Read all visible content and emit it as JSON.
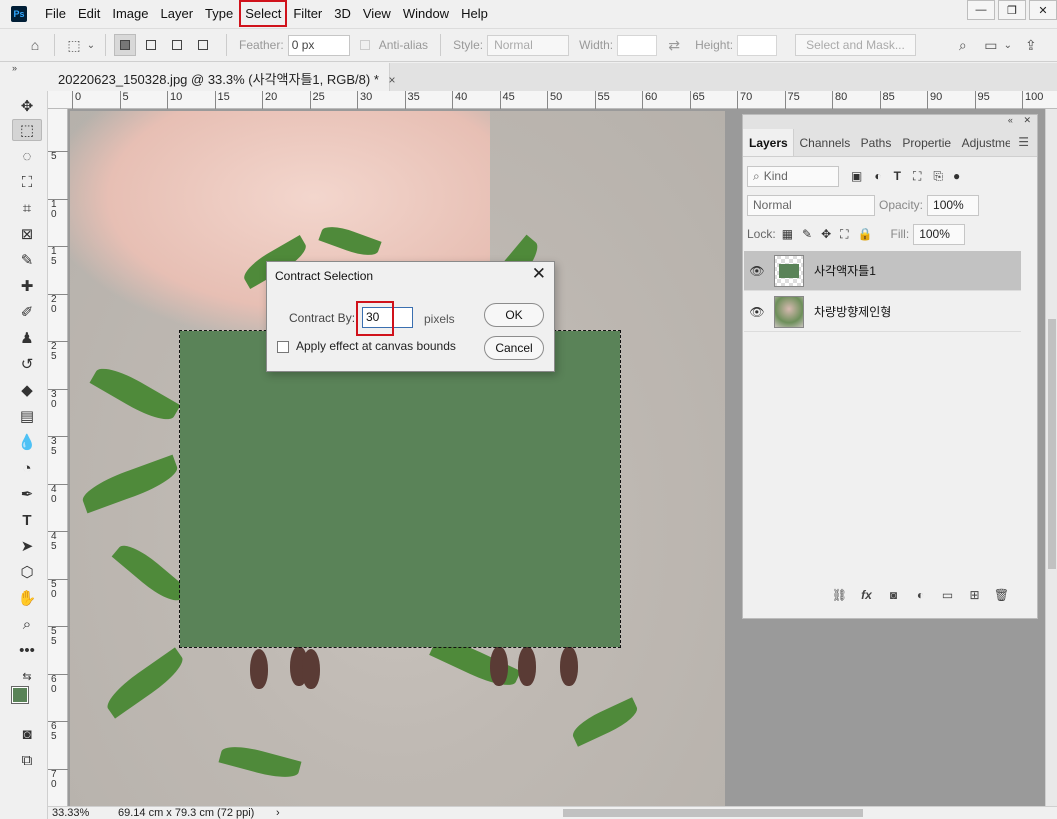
{
  "app": {
    "logo": "Ps"
  },
  "menu": [
    "File",
    "Edit",
    "Image",
    "Layer",
    "Type",
    "Select",
    "Filter",
    "3D",
    "View",
    "Window",
    "Help"
  ],
  "window_controls": {
    "minimize": "—",
    "restore": "❐",
    "close": "✕"
  },
  "options": {
    "feather_label": "Feather:",
    "feather_value": "0 px",
    "antialias_label": "Anti-alias",
    "style_label": "Style:",
    "style_value": "Normal",
    "width_label": "Width:",
    "height_label": "Height:",
    "select_mask_label": "Select and Mask..."
  },
  "tab": {
    "title": "20220623_150328.jpg @ 33.3% (사각액자틀1, RGB/8) *",
    "close": "×",
    "collapse": "»"
  },
  "ruler": {
    "h_labels": [
      "0",
      "5",
      "10",
      "15",
      "20",
      "25",
      "30",
      "35",
      "40",
      "45",
      "50",
      "55",
      "60",
      "65",
      "70",
      "75",
      "80",
      "85",
      "90",
      "95",
      "100"
    ],
    "v_labels": [
      "5",
      "1 0",
      "1 5",
      "2 0",
      "2 5",
      "3 0",
      "3 5",
      "4 0",
      "4 5",
      "5 0",
      "5 5",
      "6 0",
      "6 5",
      "7 0"
    ]
  },
  "layers_panel": {
    "collapse": "«",
    "close": "✕",
    "tabs": [
      "Layers",
      "Channels",
      "Paths",
      "Propertie",
      "Adjustme"
    ],
    "menu_icon": "☰",
    "kind_label": "Kind",
    "blend_mode": "Normal",
    "opacity_label": "Opacity:",
    "opacity_value": "100%",
    "lock_label": "Lock:",
    "fill_label": "Fill:",
    "fill_value": "100%",
    "layers": [
      {
        "name": "사각액자틀1",
        "selected": true
      },
      {
        "name": "차량방향제인형",
        "selected": false
      }
    ]
  },
  "status": {
    "zoom": "33.33%",
    "doc_size": "69.14 cm x 79.3 cm (72 ppi)",
    "arrow": "›"
  },
  "dialog": {
    "title": "Contract Selection",
    "contract_label": "Contract By:",
    "contract_value": "30",
    "unit": "pixels",
    "ok": "OK",
    "cancel": "Cancel",
    "canvas_bounds_label": "Apply effect at canvas bounds"
  },
  "colors": {
    "fill_green": "#5a8358",
    "accent_red": "#d0121b",
    "foreground_swatch": "#5a8358",
    "background_swatch": "#ffffff"
  }
}
